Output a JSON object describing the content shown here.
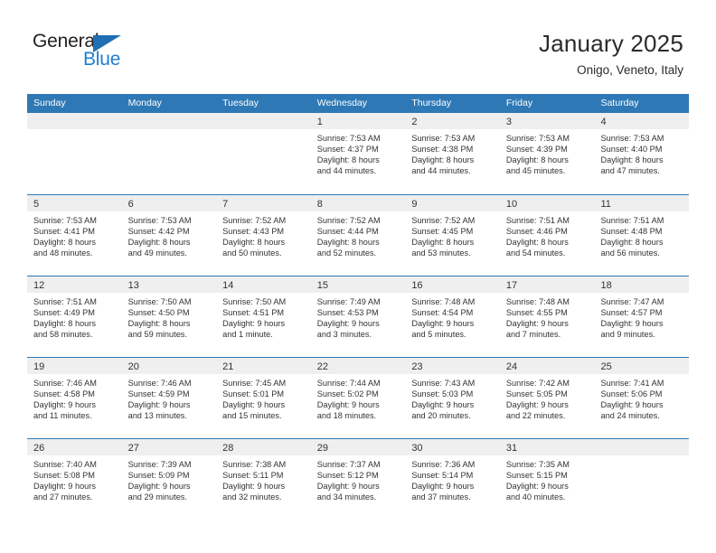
{
  "logo": {
    "word_primary": "General",
    "word_secondary": "Blue",
    "triangle_color": "#1f6fb4",
    "secondary_color": "#1f7fd0"
  },
  "header": {
    "title": "January 2025",
    "subtitle": "Onigo, Veneto, Italy"
  },
  "theme": {
    "header_blue": "#2e79b5",
    "date_band_gray": "#efefef",
    "text_color": "#333333"
  },
  "weekdays": [
    "Sunday",
    "Monday",
    "Tuesday",
    "Wednesday",
    "Thursday",
    "Friday",
    "Saturday"
  ],
  "weeks": [
    [
      {
        "day": "",
        "empty": true,
        "l1": "",
        "l2": "",
        "l3": "",
        "l4": ""
      },
      {
        "day": "",
        "empty": true,
        "l1": "",
        "l2": "",
        "l3": "",
        "l4": ""
      },
      {
        "day": "",
        "empty": true,
        "l1": "",
        "l2": "",
        "l3": "",
        "l4": ""
      },
      {
        "day": "1",
        "l1": "Sunrise: 7:53 AM",
        "l2": "Sunset: 4:37 PM",
        "l3": "Daylight: 8 hours",
        "l4": "and 44 minutes."
      },
      {
        "day": "2",
        "l1": "Sunrise: 7:53 AM",
        "l2": "Sunset: 4:38 PM",
        "l3": "Daylight: 8 hours",
        "l4": "and 44 minutes."
      },
      {
        "day": "3",
        "l1": "Sunrise: 7:53 AM",
        "l2": "Sunset: 4:39 PM",
        "l3": "Daylight: 8 hours",
        "l4": "and 45 minutes."
      },
      {
        "day": "4",
        "l1": "Sunrise: 7:53 AM",
        "l2": "Sunset: 4:40 PM",
        "l3": "Daylight: 8 hours",
        "l4": "and 47 minutes."
      }
    ],
    [
      {
        "day": "5",
        "l1": "Sunrise: 7:53 AM",
        "l2": "Sunset: 4:41 PM",
        "l3": "Daylight: 8 hours",
        "l4": "and 48 minutes."
      },
      {
        "day": "6",
        "l1": "Sunrise: 7:53 AM",
        "l2": "Sunset: 4:42 PM",
        "l3": "Daylight: 8 hours",
        "l4": "and 49 minutes."
      },
      {
        "day": "7",
        "l1": "Sunrise: 7:52 AM",
        "l2": "Sunset: 4:43 PM",
        "l3": "Daylight: 8 hours",
        "l4": "and 50 minutes."
      },
      {
        "day": "8",
        "l1": "Sunrise: 7:52 AM",
        "l2": "Sunset: 4:44 PM",
        "l3": "Daylight: 8 hours",
        "l4": "and 52 minutes."
      },
      {
        "day": "9",
        "l1": "Sunrise: 7:52 AM",
        "l2": "Sunset: 4:45 PM",
        "l3": "Daylight: 8 hours",
        "l4": "and 53 minutes."
      },
      {
        "day": "10",
        "l1": "Sunrise: 7:51 AM",
        "l2": "Sunset: 4:46 PM",
        "l3": "Daylight: 8 hours",
        "l4": "and 54 minutes."
      },
      {
        "day": "11",
        "l1": "Sunrise: 7:51 AM",
        "l2": "Sunset: 4:48 PM",
        "l3": "Daylight: 8 hours",
        "l4": "and 56 minutes."
      }
    ],
    [
      {
        "day": "12",
        "l1": "Sunrise: 7:51 AM",
        "l2": "Sunset: 4:49 PM",
        "l3": "Daylight: 8 hours",
        "l4": "and 58 minutes."
      },
      {
        "day": "13",
        "l1": "Sunrise: 7:50 AM",
        "l2": "Sunset: 4:50 PM",
        "l3": "Daylight: 8 hours",
        "l4": "and 59 minutes."
      },
      {
        "day": "14",
        "l1": "Sunrise: 7:50 AM",
        "l2": "Sunset: 4:51 PM",
        "l3": "Daylight: 9 hours",
        "l4": "and 1 minute."
      },
      {
        "day": "15",
        "l1": "Sunrise: 7:49 AM",
        "l2": "Sunset: 4:53 PM",
        "l3": "Daylight: 9 hours",
        "l4": "and 3 minutes."
      },
      {
        "day": "16",
        "l1": "Sunrise: 7:48 AM",
        "l2": "Sunset: 4:54 PM",
        "l3": "Daylight: 9 hours",
        "l4": "and 5 minutes."
      },
      {
        "day": "17",
        "l1": "Sunrise: 7:48 AM",
        "l2": "Sunset: 4:55 PM",
        "l3": "Daylight: 9 hours",
        "l4": "and 7 minutes."
      },
      {
        "day": "18",
        "l1": "Sunrise: 7:47 AM",
        "l2": "Sunset: 4:57 PM",
        "l3": "Daylight: 9 hours",
        "l4": "and 9 minutes."
      }
    ],
    [
      {
        "day": "19",
        "l1": "Sunrise: 7:46 AM",
        "l2": "Sunset: 4:58 PM",
        "l3": "Daylight: 9 hours",
        "l4": "and 11 minutes."
      },
      {
        "day": "20",
        "l1": "Sunrise: 7:46 AM",
        "l2": "Sunset: 4:59 PM",
        "l3": "Daylight: 9 hours",
        "l4": "and 13 minutes."
      },
      {
        "day": "21",
        "l1": "Sunrise: 7:45 AM",
        "l2": "Sunset: 5:01 PM",
        "l3": "Daylight: 9 hours",
        "l4": "and 15 minutes."
      },
      {
        "day": "22",
        "l1": "Sunrise: 7:44 AM",
        "l2": "Sunset: 5:02 PM",
        "l3": "Daylight: 9 hours",
        "l4": "and 18 minutes."
      },
      {
        "day": "23",
        "l1": "Sunrise: 7:43 AM",
        "l2": "Sunset: 5:03 PM",
        "l3": "Daylight: 9 hours",
        "l4": "and 20 minutes."
      },
      {
        "day": "24",
        "l1": "Sunrise: 7:42 AM",
        "l2": "Sunset: 5:05 PM",
        "l3": "Daylight: 9 hours",
        "l4": "and 22 minutes."
      },
      {
        "day": "25",
        "l1": "Sunrise: 7:41 AM",
        "l2": "Sunset: 5:06 PM",
        "l3": "Daylight: 9 hours",
        "l4": "and 24 minutes."
      }
    ],
    [
      {
        "day": "26",
        "l1": "Sunrise: 7:40 AM",
        "l2": "Sunset: 5:08 PM",
        "l3": "Daylight: 9 hours",
        "l4": "and 27 minutes."
      },
      {
        "day": "27",
        "l1": "Sunrise: 7:39 AM",
        "l2": "Sunset: 5:09 PM",
        "l3": "Daylight: 9 hours",
        "l4": "and 29 minutes."
      },
      {
        "day": "28",
        "l1": "Sunrise: 7:38 AM",
        "l2": "Sunset: 5:11 PM",
        "l3": "Daylight: 9 hours",
        "l4": "and 32 minutes."
      },
      {
        "day": "29",
        "l1": "Sunrise: 7:37 AM",
        "l2": "Sunset: 5:12 PM",
        "l3": "Daylight: 9 hours",
        "l4": "and 34 minutes."
      },
      {
        "day": "30",
        "l1": "Sunrise: 7:36 AM",
        "l2": "Sunset: 5:14 PM",
        "l3": "Daylight: 9 hours",
        "l4": "and 37 minutes."
      },
      {
        "day": "31",
        "l1": "Sunrise: 7:35 AM",
        "l2": "Sunset: 5:15 PM",
        "l3": "Daylight: 9 hours",
        "l4": "and 40 minutes."
      },
      {
        "day": "",
        "empty": true,
        "l1": "",
        "l2": "",
        "l3": "",
        "l4": ""
      }
    ]
  ]
}
